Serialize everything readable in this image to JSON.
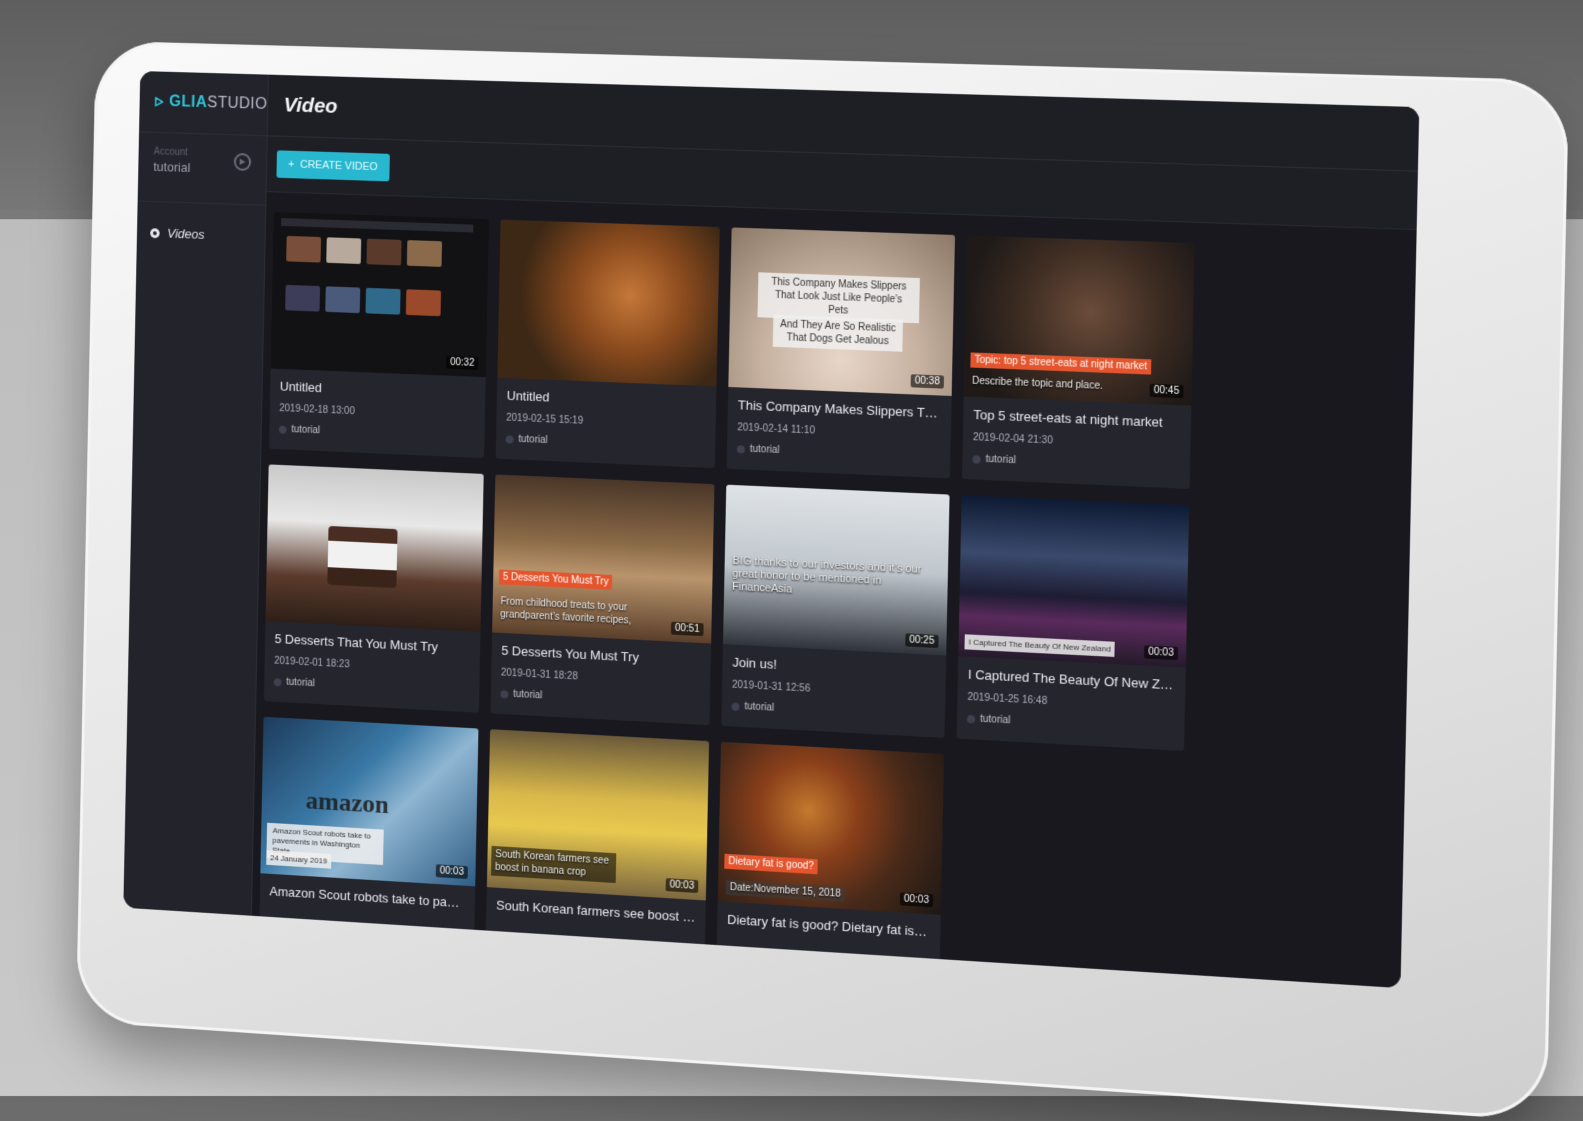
{
  "app": {
    "logo_prefix": "GLIA",
    "logo_suffix": "STUDIO",
    "account_label": "Account",
    "account_name": "tutorial",
    "nav_videos": "Videos",
    "page_title": "Video",
    "create_button": "CREATE VIDEO",
    "create_icon": "+"
  },
  "colors": {
    "accent": "#27b8cf",
    "sidebar_bg": "#23232b",
    "card_bg": "#25252d",
    "overlay_red": "#e4552e"
  },
  "videos": [
    {
      "title": "Untitled",
      "date": "2019-02-18 13:00",
      "owner": "tutorial",
      "duration": "00:32"
    },
    {
      "title": "Untitled",
      "date": "2019-02-15 15:19",
      "owner": "tutorial",
      "duration": ""
    },
    {
      "title": "This Company Makes Slippers That Lo...",
      "date": "2019-02-14 11:10",
      "owner": "tutorial",
      "duration": "00:38",
      "overlay1": "This Company Makes Slippers That Look Just Like People’s Pets",
      "overlay2": "And They Are So Realistic That Dogs Get Jealous"
    },
    {
      "title": "Top 5 street-eats at night market",
      "date": "2019-02-04 21:30",
      "owner": "tutorial",
      "duration": "00:45",
      "overlay1": "Topic: top 5 street-eats at night market",
      "overlay2": "Describe the topic and place."
    },
    {
      "title": "5 Desserts That You Must Try",
      "date": "2019-02-01 18:23",
      "owner": "tutorial",
      "duration": ""
    },
    {
      "title": "5 Desserts You Must Try",
      "date": "2019-01-31 18:28",
      "owner": "tutorial",
      "duration": "00:51",
      "overlay1": "5 Desserts You Must Try",
      "overlay2": "From childhood treats to your grandparent’s favorite recipes,"
    },
    {
      "title": "Join us!",
      "date": "2019-01-31 12:56",
      "owner": "tutorial",
      "duration": "00:25",
      "overlay1": "BIG thanks to our investors and it’s our great honor to be mentioned in FinanceAsia"
    },
    {
      "title": "I Captured The Beauty Of New Zealand",
      "date": "2019-01-25 16:48",
      "owner": "tutorial",
      "duration": "00:03",
      "overlay1": "I Captured The Beauty Of New Zealand"
    },
    {
      "title": "Amazon Scout robots take to pavemen...",
      "date": "",
      "owner": "",
      "duration": "00:03",
      "overlay1": "Amazon Scout robots take to pavements in Washington State",
      "overlay2": "24 January 2019",
      "logo": "amazon"
    },
    {
      "title": "South Korean farmers see boost in ban...",
      "date": "",
      "owner": "",
      "duration": "00:03",
      "overlay1": "South Korean farmers see boost in banana crop"
    },
    {
      "title": "Dietary fat is good? Dietary fat is bad? ...",
      "date": "",
      "owner": "",
      "duration": "00:03",
      "overlay1": "Dietary fat is good?",
      "overlay2": "Date:November 15, 2018"
    }
  ]
}
